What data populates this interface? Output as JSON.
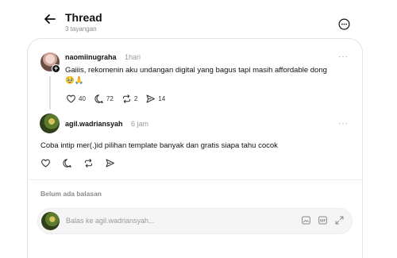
{
  "header": {
    "title": "Thread",
    "views": "3 tayangan"
  },
  "post1": {
    "username": "naomiinugraha",
    "time": "1hari",
    "text_line1": "Gaiiis, rekomenin aku undangan digital yang bagus tapi masih affordable dong",
    "text_line2": "🥹🙏",
    "more": "···",
    "likes": "40",
    "comments": "72",
    "reposts": "2",
    "shares": "14"
  },
  "post2": {
    "username": "agil.wadriansyah",
    "time": "6 jam",
    "text": "Coba intip mer(.)id pilihan template banyak dan gratis siapa tahu cocok",
    "more": "···"
  },
  "replies": {
    "empty_label": "Belum ada balasan"
  },
  "reply_box": {
    "placeholder": "Balas ke agil.wadriansyah...",
    "gif_label": "GIF"
  },
  "icons": {
    "back": "back-arrow-icon",
    "more": "more-circle-icon",
    "like": "heart-icon",
    "comment": "comment-icon",
    "repost": "repost-icon",
    "share": "send-icon",
    "image": "image-icon",
    "gif": "gif-icon",
    "expand": "expand-icon"
  }
}
